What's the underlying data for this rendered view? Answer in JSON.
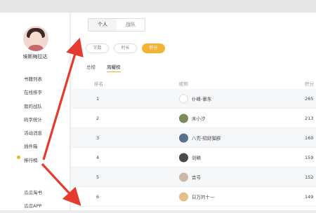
{
  "sidebar": {
    "username": "埃斯梅拉达",
    "items": [
      "书籍列表",
      "在线排字",
      "我的战队",
      "码字统计",
      "活动消息",
      "插件箱",
      "排行榜"
    ],
    "bottom_items": [
      "瓜瓜淘书",
      "瓜瓜APP"
    ],
    "active_index": 6
  },
  "main": {
    "segments": [
      "个人",
      "战队"
    ],
    "pills": [
      "字数",
      "时长",
      "积分"
    ],
    "tabs": [
      "总榜",
      "周耀榜"
    ],
    "columns": [
      "排名",
      "昵称",
      "积分"
    ],
    "rows": [
      {
        "rank": "1",
        "name": "仆峰-豪东",
        "score": "265"
      },
      {
        "rank": "2",
        "name": "末小汐",
        "score": "213"
      },
      {
        "rank": "3",
        "name": "八壳-招财猫豚",
        "score": "160"
      },
      {
        "rank": "4",
        "name": "剑鳞",
        "score": "159"
      },
      {
        "rank": "5",
        "name": "吉号",
        "score": "152"
      },
      {
        "rank": "6",
        "name": "日万的十一",
        "score": "149"
      }
    ]
  },
  "colors": {
    "accent": "#f3b238",
    "arrow": "#e53a2f"
  }
}
